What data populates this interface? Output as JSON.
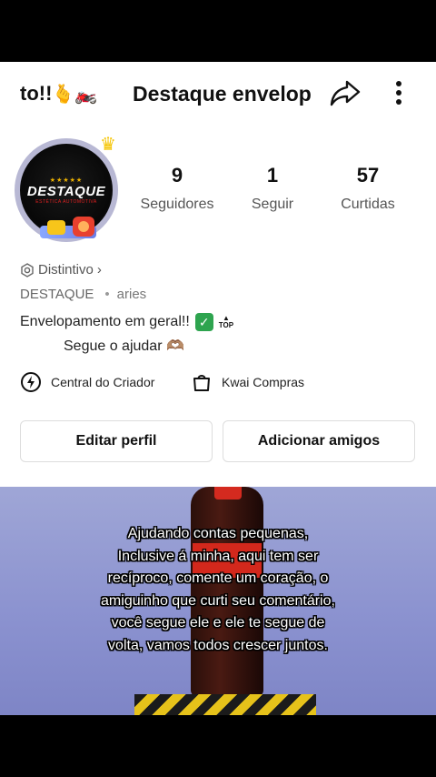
{
  "header": {
    "left_name": "to!!",
    "left_emoji": "🫰🏍️",
    "title": "Destaque envelop",
    "share_icon": "share-arrow-icon",
    "more_icon": "more-vertical-icon"
  },
  "avatar": {
    "stars": "★★★★★",
    "logo_text": "DESTAQUE",
    "logo_sub": "ESTÉTICA AUTOMOTIVA",
    "crown_icon": "crown-icon"
  },
  "stats": [
    {
      "value": "9",
      "label": "Seguidores"
    },
    {
      "value": "1",
      "label": "Seguir"
    },
    {
      "value": "57",
      "label": "Curtidas"
    }
  ],
  "badge_link": {
    "label": "Distintivo",
    "chevron": "›"
  },
  "tags": {
    "first": "DESTAQUE",
    "second": "aries"
  },
  "bio": {
    "line1": "Envelopamento em geral!!",
    "check": "✓",
    "top_label": "TOP",
    "line2": "Segue o ajudar 🫶🏽"
  },
  "tools": {
    "creator": "Central do Criador",
    "shop": "Kwai Compras"
  },
  "buttons": {
    "edit": "Editar perfil",
    "add": "Adicionar amigos"
  },
  "video": {
    "caption": "Ajudando contas pequenas, Inclusive á minha, aqui tem ser recíproco, comente um coração, o amiguinho que curti seu comentário, você segue ele e ele te segue de volta, vamos todos crescer juntos."
  },
  "colors": {
    "text_primary": "#111111",
    "text_secondary": "#555555",
    "check_green": "#2ea44f",
    "badge_red": "#e8402e",
    "video_bg": "#9fa6d6"
  }
}
